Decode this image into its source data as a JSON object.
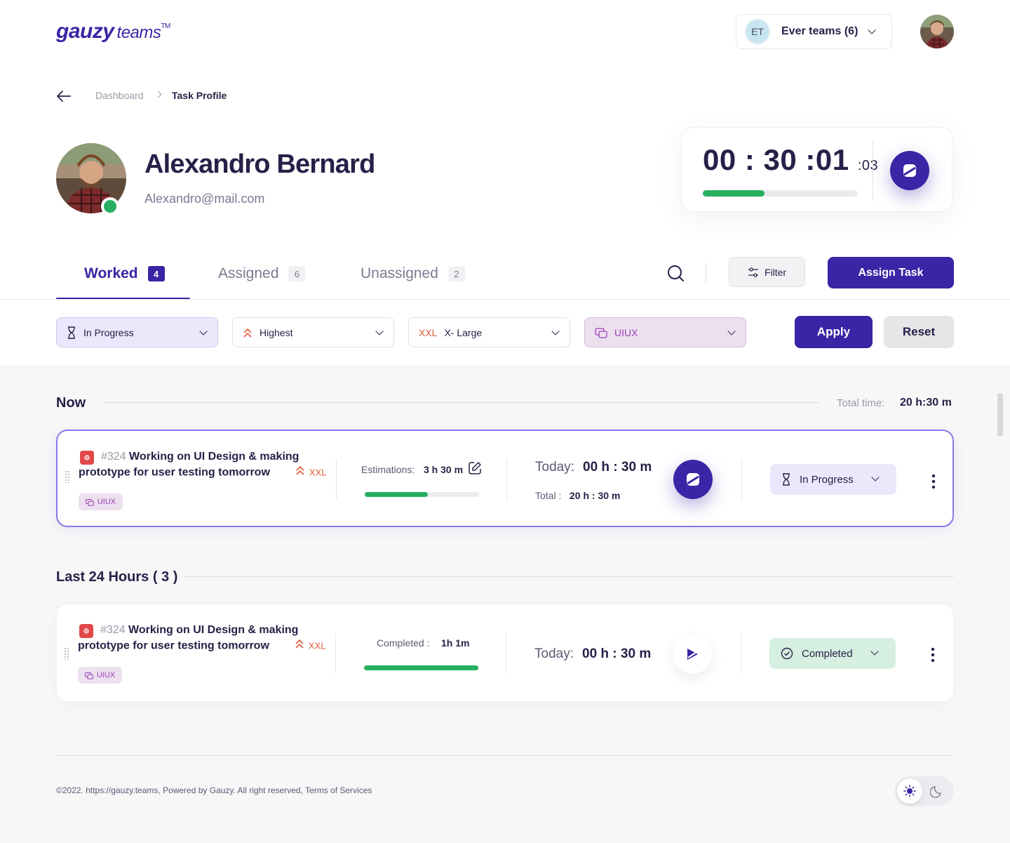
{
  "header": {
    "logo_main": "gauzy",
    "logo_sub": "teams",
    "logo_tm": "TM",
    "team": {
      "initials": "ET",
      "name": "Ever teams (6)"
    }
  },
  "breadcrumb": {
    "parent": "Dashboard",
    "current": "Task Profile"
  },
  "profile": {
    "name": "Alexandro Bernard",
    "email": "Alexandro@mail.com"
  },
  "timer": {
    "main": "00 : 30 :01",
    "seconds": ":03",
    "progress": 0.4
  },
  "tabs": [
    {
      "label": "Worked",
      "count": "4"
    },
    {
      "label": "Assigned",
      "count": "6"
    },
    {
      "label": "Unassigned",
      "count": "2"
    }
  ],
  "toolbar": {
    "filter_label": "Filter",
    "assign_label": "Assign Task"
  },
  "filters": {
    "status": "In Progress",
    "priority": "Highest",
    "size_tag": "XXL",
    "size": "X- Large",
    "label": "UIUX",
    "apply": "Apply",
    "reset": "Reset"
  },
  "sections": {
    "now": {
      "title": "Now",
      "total_label": "Total time:",
      "total_value": "20 h:30 m"
    },
    "last24": {
      "title": "Last 24 Hours ( 3 )"
    }
  },
  "cards": [
    {
      "number": "#324",
      "title": "Working on UI Design & making prototype for user testing tomorrow",
      "size": "XXL",
      "label": "UIUX",
      "estimation_label": "Estimations:",
      "estimation_value": "3 h 30 m",
      "progress": 0.55,
      "today_label": "Today:",
      "today_value": "00 h : 30 m",
      "total_label": "Total :",
      "total_value": "20 h : 30 m",
      "status": "In Progress"
    },
    {
      "number": "#324",
      "title": "Working on UI Design & making prototype for user testing tomorrow",
      "size": "XXL",
      "label": "UIUX",
      "completed_label": "Completed :",
      "completed_value": "1h 1m",
      "progress": 1.0,
      "today_label": "Today:",
      "today_value": "00 h : 30 m",
      "status": "Completed"
    }
  ],
  "footer": {
    "text": "©2022. https://gauzy.teams, Powered by Gauzy. All right reserved, Terms of Services"
  },
  "colors": {
    "primary": "#3826a6",
    "success": "#27ae60",
    "danger": "#e14848",
    "label": "#9b3fb6",
    "size_orange": "#e05a3a"
  }
}
